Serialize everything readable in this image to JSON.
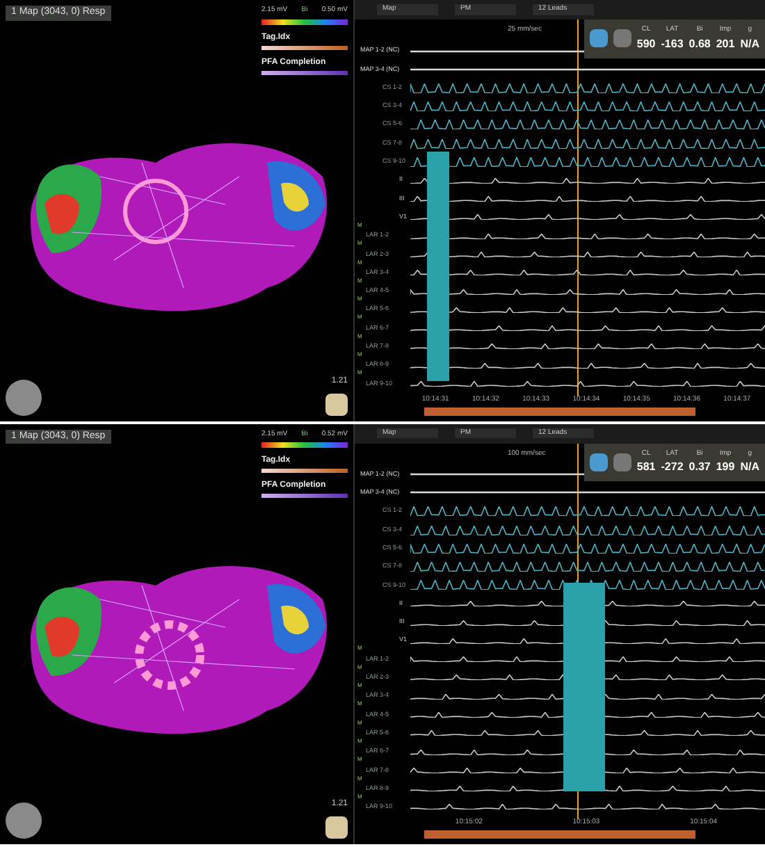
{
  "panels": [
    {
      "map": {
        "title": "1 Map (3043, 0) Resp",
        "scale_min": "2.15 mV",
        "scale_label": "Bi",
        "scale_max": "0.50 mV",
        "legend": [
          "Tag.Idx",
          "PFA Completion"
        ],
        "zoom": "1.21"
      },
      "egm": {
        "toolbar": [
          "Map",
          "PM",
          "12 Leads"
        ],
        "speed": "25 mm/sec",
        "info": [
          {
            "label": "CL",
            "value": "590"
          },
          {
            "label": "LAT",
            "value": "-163"
          },
          {
            "label": "Bi",
            "value": "0.68"
          },
          {
            "label": "Imp",
            "value": "201"
          },
          {
            "label": "g",
            "value": "N/A"
          }
        ],
        "channels": [
          {
            "label": "MAP 1-2 (NC)",
            "kind": "map"
          },
          {
            "label": "MAP 3-4 (NC)",
            "kind": "map"
          },
          {
            "label": "CS 1-2",
            "kind": "cs"
          },
          {
            "label": "CS 3-4",
            "kind": "cs"
          },
          {
            "label": "CS 5-6",
            "kind": "cs"
          },
          {
            "label": "CS 7-8",
            "kind": "cs"
          },
          {
            "label": "CS 9-10",
            "kind": "cs"
          },
          {
            "label": "II",
            "kind": "ecg"
          },
          {
            "label": "III",
            "kind": "ecg"
          },
          {
            "label": "V1",
            "kind": "ecg"
          },
          {
            "label": "LAR 1-2",
            "kind": "lar",
            "tag": "M"
          },
          {
            "label": "LAR 2-3",
            "kind": "lar",
            "tag": "M"
          },
          {
            "label": "LAR 3-4",
            "kind": "lar",
            "tag": "M"
          },
          {
            "label": "LAR 4-5",
            "kind": "lar",
            "tag": "M"
          },
          {
            "label": "LAR 5-6",
            "kind": "lar",
            "tag": "M"
          },
          {
            "label": "LAR 6-7",
            "kind": "lar",
            "tag": "M"
          },
          {
            "label": "LAR 7-8",
            "kind": "lar",
            "tag": "M"
          },
          {
            "label": "LAR 8-9",
            "kind": "lar",
            "tag": "M"
          },
          {
            "label": "LAR 9-10",
            "kind": "lar",
            "tag": "M"
          }
        ],
        "times": [
          "10:14:31",
          "10:14:32",
          "10:14:33",
          "10:14:34",
          "10:14:35",
          "10:14:36",
          "10:14:37"
        ]
      }
    },
    {
      "map": {
        "title": "1 Map (3043, 0) Resp",
        "scale_min": "2.15 mV",
        "scale_label": "Bi",
        "scale_max": "0.52 mV",
        "legend": [
          "Tag.Idx",
          "PFA Completion"
        ],
        "zoom": "1.21"
      },
      "egm": {
        "toolbar": [
          "Map",
          "PM",
          "12 Leads"
        ],
        "speed": "100 mm/sec",
        "info": [
          {
            "label": "CL",
            "value": "581"
          },
          {
            "label": "LAT",
            "value": "-272"
          },
          {
            "label": "Bi",
            "value": "0.37"
          },
          {
            "label": "Imp",
            "value": "199"
          },
          {
            "label": "g",
            "value": "N/A"
          }
        ],
        "channels": [
          {
            "label": "MAP 1-2 (NC)",
            "kind": "map"
          },
          {
            "label": "MAP 3-4 (NC)",
            "kind": "map"
          },
          {
            "label": "CS 1-2",
            "kind": "cs"
          },
          {
            "label": "CS 3-4",
            "kind": "cs"
          },
          {
            "label": "CS 5-6",
            "kind": "cs"
          },
          {
            "label": "CS 7-8",
            "kind": "cs"
          },
          {
            "label": "CS 9-10",
            "kind": "cs"
          },
          {
            "label": "II",
            "kind": "ecg"
          },
          {
            "label": "III",
            "kind": "ecg"
          },
          {
            "label": "V1",
            "kind": "ecg"
          },
          {
            "label": "LAR 1-2",
            "kind": "lar",
            "tag": "M"
          },
          {
            "label": "LAR 2-3",
            "kind": "lar",
            "tag": "M"
          },
          {
            "label": "LAR 3-4",
            "kind": "lar",
            "tag": "M"
          },
          {
            "label": "LAR 4-5",
            "kind": "lar",
            "tag": "M"
          },
          {
            "label": "LAR 5-6",
            "kind": "lar",
            "tag": "M"
          },
          {
            "label": "LAR 6-7",
            "kind": "lar",
            "tag": "M"
          },
          {
            "label": "LAR 7-8",
            "kind": "lar",
            "tag": "M"
          },
          {
            "label": "LAR 8-9",
            "kind": "lar",
            "tag": "M"
          },
          {
            "label": "LAR 9-10",
            "kind": "lar",
            "tag": "M"
          }
        ],
        "times": [
          "10:15:02",
          "10:15:03",
          "10:15:04"
        ]
      }
    }
  ]
}
